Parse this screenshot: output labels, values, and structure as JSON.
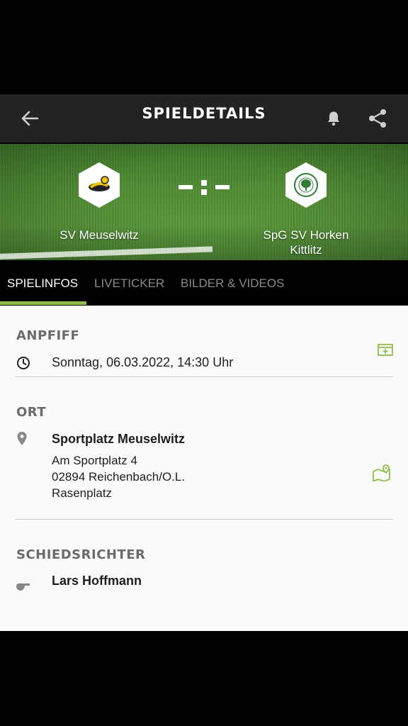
{
  "header": {
    "title": "SPIELDETAILS",
    "back_icon": "arrow-left-icon",
    "bell_icon": "bell-icon",
    "share_icon": "share-icon"
  },
  "match": {
    "home_team": "SV Meuselwitz",
    "away_team": "SpG SV Horken Kittlitz",
    "score": "-:-"
  },
  "tabs": [
    {
      "label": "SPIELINFOS",
      "active": true
    },
    {
      "label": "LIVETICKER",
      "active": false
    },
    {
      "label": "BILDER & VIDEOS",
      "active": false
    }
  ],
  "kickoff": {
    "heading": "ANPFIFF",
    "datetime": "Sonntag, 06.03.2022, 14:30 Uhr"
  },
  "location": {
    "heading": "ORT",
    "venue": "Sportplatz Meuselwitz",
    "street": "Am Sportplatz 4",
    "city": "02894 Reichenbach/O.L.",
    "surface": "Rasenplatz"
  },
  "referee": {
    "heading": "SCHIEDSRICHTER",
    "name": "Lars Hoffmann"
  },
  "colors": {
    "accent": "#8fbf4a",
    "topbar": "#232323",
    "background": "#fafafa"
  }
}
